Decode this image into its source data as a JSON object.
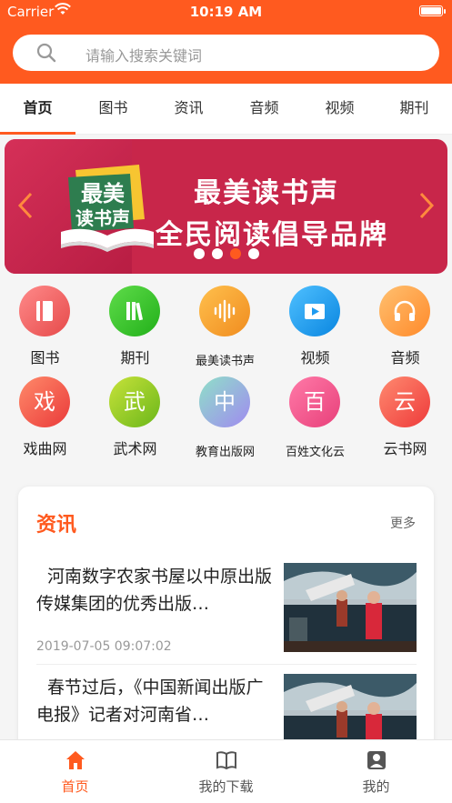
{
  "status": {
    "carrier": "Carrier",
    "time": "10:19 AM"
  },
  "search": {
    "placeholder": "请输入搜索关键词"
  },
  "tabs": [
    {
      "label": "首页",
      "active": true
    },
    {
      "label": "图书"
    },
    {
      "label": "资讯"
    },
    {
      "label": "音频"
    },
    {
      "label": "视频"
    },
    {
      "label": "期刊"
    }
  ],
  "banner": {
    "title_line1": "最美读书声",
    "title_line2": "全民阅读倡导品牌",
    "logo_text_1": "最美",
    "logo_text_2": "读书声",
    "slides": 4,
    "active_slide": 3
  },
  "grid": [
    {
      "label": "图书",
      "icon": "book-icon",
      "color": "#f46a6a",
      "glyph": ""
    },
    {
      "label": "期刊",
      "icon": "journal-icon",
      "color": "#36c22e",
      "glyph": ""
    },
    {
      "label": "最美读书声",
      "icon": "audio-wave-icon",
      "color": "#f6a32a",
      "glyph": "",
      "small": true
    },
    {
      "label": "视频",
      "icon": "video-icon",
      "color": "#1f9bf0",
      "glyph": ""
    },
    {
      "label": "音频",
      "icon": "headphones-icon",
      "color": "#ff9d3c",
      "glyph": ""
    },
    {
      "label": "戏曲网",
      "icon": "opera-icon",
      "color": "#f25a4f",
      "glyph": "戏"
    },
    {
      "label": "武术网",
      "icon": "martial-icon",
      "color": "#8bc61d",
      "glyph": "武"
    },
    {
      "label": "教育出版网",
      "icon": "education-icon",
      "color": "#9ea9f0",
      "glyph": "中",
      "small": true
    },
    {
      "label": "百姓文化云",
      "icon": "culture-icon",
      "color": "#f25a8a",
      "glyph": "百",
      "small": true
    },
    {
      "label": "云书网",
      "icon": "cloud-book-icon",
      "color": "#f55b4c",
      "glyph": "云"
    }
  ],
  "news": {
    "heading": "资讯",
    "more": "更多",
    "items": [
      {
        "title": "河南数字农家书屋以中原出版传媒集团的优秀出版…",
        "date": "2019-07-05 09:07:02"
      },
      {
        "title": "春节过后，《中国新闻出版广电报》记者对河南省…",
        "date": ""
      }
    ]
  },
  "bottombar": [
    {
      "label": "首页",
      "icon": "home-icon",
      "active": true
    },
    {
      "label": "我的下载",
      "icon": "download-book-icon"
    },
    {
      "label": "我的",
      "icon": "profile-icon"
    }
  ],
  "colors": {
    "accent": "#ff5a1f",
    "banner": "#c8264a"
  }
}
